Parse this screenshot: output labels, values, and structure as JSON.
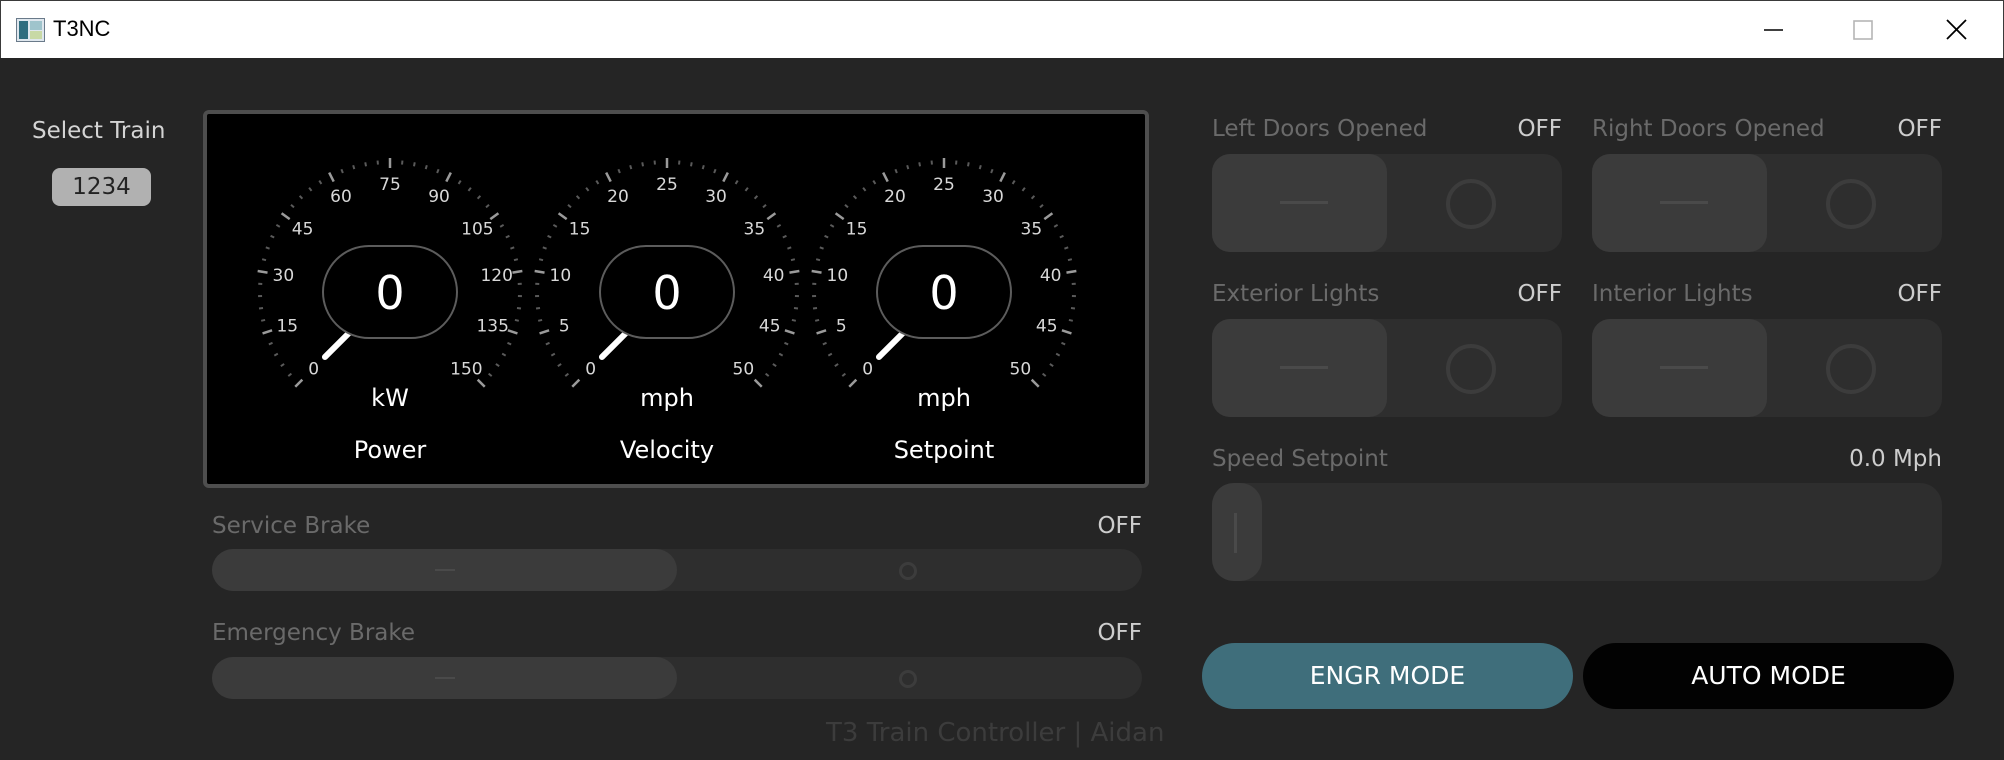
{
  "window": {
    "title": "T3NC",
    "minimize_icon": "minimize-icon",
    "maximize_icon": "maximize-icon",
    "close_icon": "close-icon"
  },
  "train_select": {
    "label": "Select Train",
    "value": "1234"
  },
  "gauges": [
    {
      "name": "Power",
      "unit": "kW",
      "value": "0",
      "ticks": [
        "0",
        "15",
        "30",
        "45",
        "60",
        "75",
        "90",
        "105",
        "120",
        "135",
        "150"
      ]
    },
    {
      "name": "Velocity",
      "unit": "mph",
      "value": "0",
      "ticks": [
        "0",
        "5",
        "10",
        "15",
        "20",
        "25",
        "30",
        "35",
        "40",
        "45",
        "50"
      ]
    },
    {
      "name": "Setpoint",
      "unit": "mph",
      "value": "0",
      "ticks": [
        "0",
        "5",
        "10",
        "15",
        "20",
        "25",
        "30",
        "35",
        "40",
        "45",
        "50"
      ]
    }
  ],
  "toggles": {
    "left_doors": {
      "label": "Left Doors Opened",
      "state": "OFF"
    },
    "right_doors": {
      "label": "Right Doors Opened",
      "state": "OFF"
    },
    "exterior_lights": {
      "label": "Exterior Lights",
      "state": "OFF"
    },
    "interior_lights": {
      "label": "Interior Lights",
      "state": "OFF"
    }
  },
  "speed_setpoint": {
    "label": "Speed Setpoint",
    "value": "0.0 Mph"
  },
  "brakes": {
    "service": {
      "label": "Service Brake",
      "state": "OFF"
    },
    "emergency": {
      "label": "Emergency Brake",
      "state": "OFF"
    }
  },
  "modes": {
    "engr_label": "ENGR MODE",
    "auto_label": "AUTO MODE"
  },
  "footer": {
    "text": "T3 Train Controller | Aidan"
  },
  "colors": {
    "background": "#252525",
    "accent_engr": "#3f6e7b",
    "auto_button": "#020202",
    "gauge_panel": "#000000"
  }
}
